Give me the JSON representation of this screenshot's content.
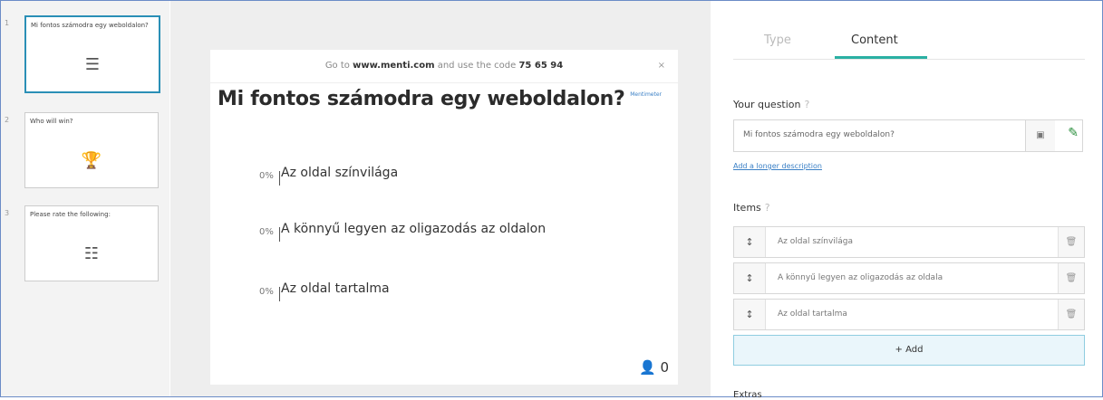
{
  "slides": [
    {
      "number": "1",
      "title": "Mi fontos számodra egy weboldalon?",
      "icon": "bars-chart-icon"
    },
    {
      "number": "2",
      "title": "Who will win?",
      "icon": "trophy-icon"
    },
    {
      "number": "3",
      "title": "Please rate the following:",
      "icon": "sliders-icon"
    }
  ],
  "preview": {
    "topbar_prefix": "Go to",
    "topbar_url": "www.menti.com",
    "topbar_middle": "and use the code",
    "topbar_code": "75 65 94",
    "question": "Mi fontos számodra egy weboldalon?",
    "brand": "Mentimeter",
    "options": [
      {
        "pct": "0%",
        "label": "Az oldal színvilága"
      },
      {
        "pct": "0%",
        "label": "A könnyű legyen az oligazodás az oldalon"
      },
      {
        "pct": "0%",
        "label": "Az oldal tartalma"
      }
    ],
    "voters": "0"
  },
  "editor": {
    "tabs": {
      "type": "Type",
      "content": "Content"
    },
    "question_heading": "Your question",
    "question_value": "Mi fontos számodra egy weboldalon?",
    "longer_desc_link": "Add a longer description",
    "items_heading": "Items",
    "items": [
      "Az oldal színvilága",
      "A könnyű legyen az oligazodás az oldala",
      "Az oldal tartalma"
    ],
    "add_label": "+ Add",
    "extras_heading": "Extras"
  },
  "colors": {
    "accent": "#2ab0a3",
    "selected": "#2a8fb6",
    "link": "#3b80c6"
  }
}
